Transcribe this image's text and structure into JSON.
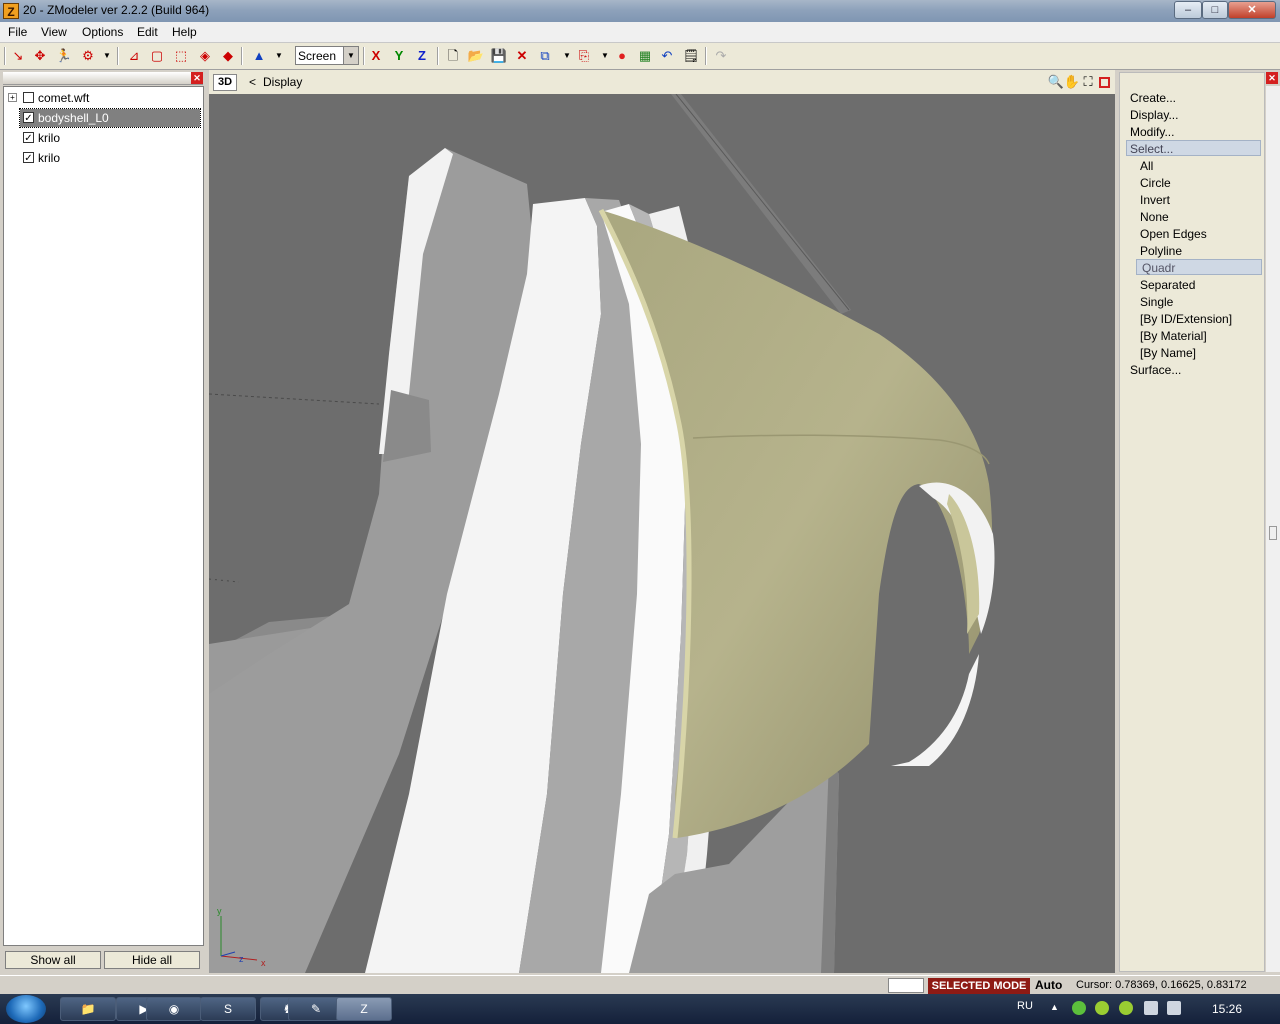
{
  "window": {
    "title": "20 - ZModeler ver 2.2.2 (Build 964)",
    "app_icon_letter": "Z"
  },
  "window_controls": {
    "minimize": "–",
    "maximize": "□",
    "close": "✕"
  },
  "menu": [
    "File",
    "View",
    "Options",
    "Edit",
    "Help"
  ],
  "toolbar": {
    "coord_system": "Screen",
    "axis_x": "X",
    "axis_y": "Y",
    "axis_z": "Z"
  },
  "tree": {
    "items": [
      {
        "label": "comet.wft",
        "checked": false,
        "expand": "+"
      },
      {
        "label": "bodyshell_L0",
        "checked": true,
        "selected": true
      },
      {
        "label": "krilo",
        "checked": true
      },
      {
        "label": "krilo",
        "checked": true
      }
    ],
    "check_mark": "✓",
    "show_all": "Show all",
    "hide_all": "Hide all"
  },
  "viewport": {
    "tab": "3D",
    "nav_arrow": "<",
    "mode": "Display",
    "axis_y": "y",
    "axis_z": "z",
    "axis_x": "x"
  },
  "commands": {
    "create": "Create...",
    "display": "Display...",
    "modify": "Modify...",
    "select": "Select...",
    "select_options": [
      "All",
      "Circle",
      "Invert",
      "None",
      "Open Edges",
      "Polyline",
      "Quadr",
      "Separated",
      "Single",
      "[By ID/Extension]",
      "[By Material]",
      "[By Name]"
    ],
    "highlighted_option": "Quadr",
    "surface": "Surface..."
  },
  "status": {
    "mode": "SELECTED MODE",
    "auto": "Auto",
    "cursor": "Cursor: 0.78369, 0.16625, 0.83172"
  },
  "taskbar": {
    "language": "RU",
    "time": "15:26",
    "active_app_letter": "Z"
  },
  "colors": {
    "panel_bg": "#d4d0c8",
    "viewport_bg": "#6f6f6f",
    "mode_badge": "#8e1a14",
    "fender": "#b3b08a"
  }
}
